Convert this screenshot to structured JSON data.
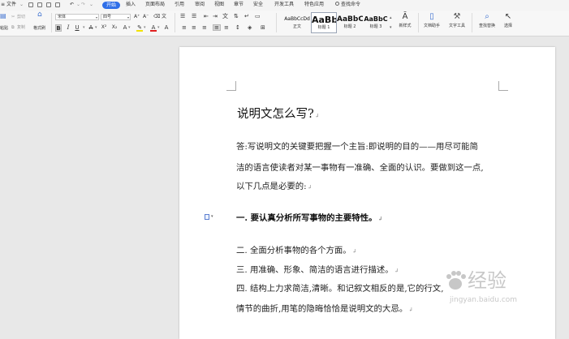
{
  "menubar": {
    "file_label": "文件",
    "tabs": [
      "开始",
      "插入",
      "页面布局",
      "引用",
      "审阅",
      "视图",
      "章节",
      "安全",
      "开发工具",
      "特色应用"
    ],
    "active_tab": "开始",
    "search_placeholder": "查找命令"
  },
  "ribbon": {
    "cut_label": "剪切",
    "copy_label": "复制",
    "format_painter_label": "格式刷",
    "paste_label": "粘贴",
    "font_name": "宋体",
    "font_size": "四号",
    "bold_label": "B",
    "italic_label": "I",
    "underline_label": "U",
    "styles": [
      {
        "preview": "AaBbCcDd",
        "label": "正文"
      },
      {
        "preview": "AaBb",
        "label": "标题 1"
      },
      {
        "preview": "AaBbC",
        "label": "标题 2"
      },
      {
        "preview": "AaBbC",
        "label": "标题 3"
      }
    ],
    "new_style_label": "新样式",
    "doc_helper_label": "文档助手",
    "text_tools_label": "文字工具",
    "find_replace_label": "查找替换",
    "select_label": "选择"
  },
  "document": {
    "title": "说明文怎么写?",
    "para1_line1": "答:写说明文的关键要把握一个主旨:即说明的目的——用尽可能简",
    "para1_line2": "洁的语言使读者对某一事物有一准确、全面的认识。要做到这一点,",
    "para1_line3": "以下几点是必要的:",
    "item1": "一. 要认真分析所写事物的主要特性。",
    "item2": "二. 全面分析事物的各个方面。",
    "item3": "三. 用准确、形象、简洁的语言进行描述。",
    "item4": "四. 结构上力求简洁,清晰。和记叙文相反的是,它的行文,",
    "item4_line2": "情节的曲折,用笔的隐晦恰恰是说明文的大忌。"
  },
  "watermark": {
    "main": "经验",
    "sub": "jingyan.baidu.com"
  }
}
